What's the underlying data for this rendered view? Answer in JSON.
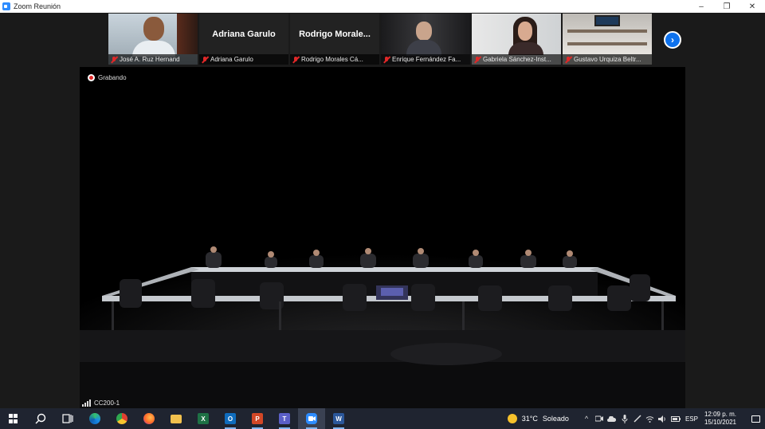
{
  "window": {
    "title": "Zoom Reunión",
    "minimize": "–",
    "restore": "❐",
    "close": "✕"
  },
  "participants": [
    {
      "name": "José A. Ruz Hernand",
      "muted": true,
      "video": true
    },
    {
      "name": "Adriana Garulo",
      "card": "Adriana Garulo",
      "muted": true,
      "video": false
    },
    {
      "name": "Rodrigo Morales Cá...",
      "card": "Rodrigo  Morale...",
      "muted": true,
      "video": false
    },
    {
      "name": "Enrique Fernández Fa...",
      "muted": true,
      "video": true
    },
    {
      "name": "Gabriela Sánchez-Inst...",
      "muted": true,
      "video": true
    },
    {
      "name": "Gustavo Urquiza Beltr...",
      "muted": true,
      "video": true
    }
  ],
  "strip": {
    "next_label": "›"
  },
  "main": {
    "recording_label": "Grabando",
    "speaker_label": "CC200-1"
  },
  "taskbar": {
    "weather_temp": "31°C",
    "weather_desc": "Soleado",
    "language": "ESP",
    "time": "12:09 p. m.",
    "date": "15/10/2021",
    "excel_letter": "X",
    "outlook_letter": "O",
    "powerpoint_letter": "P",
    "teams_letter": "T",
    "word_letter": "W",
    "chevron": "^"
  },
  "colors": {
    "zoom_blue": "#0e72ed",
    "mute_red": "#e02828",
    "taskbar": "#1f2430"
  }
}
